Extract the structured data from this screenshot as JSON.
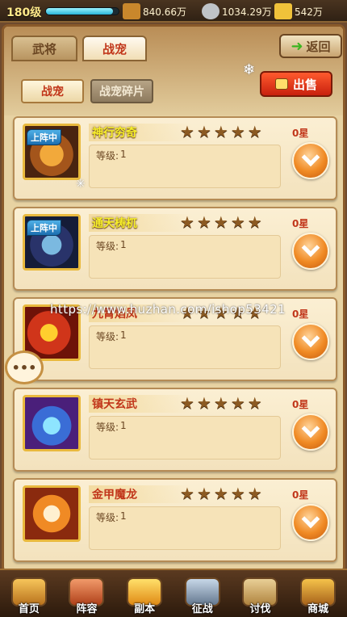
{
  "topbar": {
    "level": "180级",
    "exp_fraction": 0.92,
    "gold": "840.66万",
    "silver": "1034.29万",
    "ingot": "542万",
    "colors": {
      "gold_icon": "#c9872c",
      "silver_icon": "#bfc3c7",
      "ingot_icon": "#f0c23a"
    }
  },
  "tabs": [
    {
      "label": "武将"
    },
    {
      "label": "战宠"
    }
  ],
  "back_label": "返回",
  "subtabs": [
    {
      "label": "战宠"
    },
    {
      "label": "战宠碎片"
    }
  ],
  "sell_label": "出售",
  "onstage_label": "上阵中",
  "level_label": "等级:",
  "pets": [
    {
      "name": "神行穷奇",
      "onstage": true,
      "stars_text": "0星",
      "level": "1",
      "name_color": "gold"
    },
    {
      "name": "通天梼杌",
      "onstage": true,
      "stars_text": "0星",
      "level": "1",
      "name_color": "gold"
    },
    {
      "name": "九霄焰凤",
      "onstage": false,
      "stars_text": "0星",
      "level": "1",
      "name_color": "red"
    },
    {
      "name": "镇天玄武",
      "onstage": false,
      "stars_text": "0星",
      "level": "1",
      "name_color": "red"
    },
    {
      "name": "金甲魔龙",
      "onstage": false,
      "stars_text": "0星",
      "level": "1",
      "name_color": "red"
    }
  ],
  "watermark": "https://www.huzhan.com/ishop53421",
  "chat_label": "•••",
  "nav": [
    {
      "label": "首页",
      "icon": "home-icon"
    },
    {
      "label": "阵容",
      "icon": "lineup-icon"
    },
    {
      "label": "副本",
      "icon": "dungeon-icon"
    },
    {
      "label": "征战",
      "icon": "campaign-icon"
    },
    {
      "label": "讨伐",
      "icon": "crusade-icon"
    },
    {
      "label": "商城",
      "icon": "shop-icon"
    }
  ]
}
